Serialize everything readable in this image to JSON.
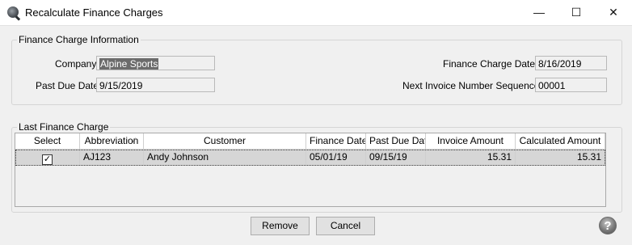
{
  "window": {
    "title": "Recalculate Finance Charges",
    "minimize_glyph": "—",
    "maximize_glyph": "☐",
    "close_glyph": "✕"
  },
  "finance_info": {
    "legend": "Finance Charge Information",
    "company_label": "Company",
    "company_value": "Alpine Sports",
    "past_due_label": "Past Due Date",
    "past_due_value": "9/15/2019",
    "finance_charge_date_label": "Finance Charge Date",
    "finance_charge_date_value": "8/16/2019",
    "next_invoice_label": "Next Invoice Number Sequence",
    "next_invoice_value": "00001"
  },
  "last_finance": {
    "legend": "Last Finance Charge",
    "columns": [
      "Select",
      "Abbreviation",
      "Customer",
      "Finance Date",
      "Past Due Dat",
      "Invoice Amount",
      "Calculated Amount"
    ],
    "sort_indicator": "⁄",
    "rows": [
      {
        "selected": "✓",
        "abbreviation": "AJ123",
        "customer": "Andy Johnson",
        "finance_date": "05/01/19",
        "past_due_date": "09/15/19",
        "invoice_amount": "15.31",
        "calculated_amount": "15.31"
      }
    ]
  },
  "buttons": {
    "remove": "Remove",
    "cancel": "Cancel",
    "help": "?"
  }
}
